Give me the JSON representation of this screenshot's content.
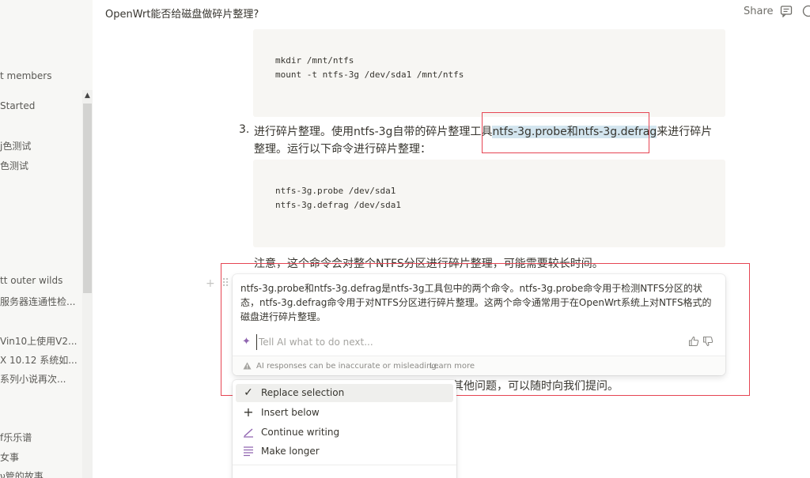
{
  "page": {
    "title": "OpenWrt能否给磁盘做碎片整理?",
    "share_label": "Share"
  },
  "sidebar": {
    "items": [
      {
        "label": "t members"
      },
      {
        "label": "Started"
      },
      {
        "label": "j色测试"
      },
      {
        "label": "色测试"
      },
      {
        "label": "tt outer wilds"
      },
      {
        "label": "服务器连通性检..."
      },
      {
        "label": "Vin10上使用V2..."
      },
      {
        "label": "X 10.12 系统如..."
      },
      {
        "label": "系列小说再次..."
      },
      {
        "label": "f乐乐谱"
      },
      {
        "label": "女事"
      },
      {
        "label": "ν管的故事"
      }
    ]
  },
  "content": {
    "code1": [
      "mkdir /mnt/ntfs",
      "mount -t ntfs-3g /dev/sda1 /mnt/ntfs"
    ],
    "step_number": "3.",
    "step_text_before": "进行碎片整理。使用ntfs-3g自带的碎片整理工具",
    "step_text_highlight": "ntfs-3g.probe和ntfs-3g.defrag",
    "step_text_after": "来进行碎片整理。运行以下命令进行碎片整理：",
    "code2": [
      "ntfs-3g.probe /dev/sda1",
      "ntfs-3g.defrag /dev/sda1"
    ],
    "note": "注意，这个命令会对整个NTFS分区进行碎片整理，可能需要较长时间。",
    "tail": "其他问题，可以随时向我们提问。"
  },
  "ai_panel": {
    "response": "ntfs-3g.probe和ntfs-3g.defrag是ntfs-3g工具包中的两个命令。ntfs-3g.probe命令用于检测NTFS分区的状态，ntfs-3g.defrag命令用于对NTFS分区进行碎片整理。这两个命令通常用于在OpenWrt系统上对NTFS格式的磁盘进行碎片整理。",
    "input_placeholder": "Tell AI what to do next...",
    "disclaimer": "AI responses can be inaccurate or misleading.",
    "learn_more": "Learn more"
  },
  "menu": {
    "items": [
      {
        "label": "Replace selection",
        "icon": "check-icon"
      },
      {
        "label": "Insert below",
        "icon": "plus-icon"
      },
      {
        "label": "Continue writing",
        "icon": "pen-icon"
      },
      {
        "label": "Make longer",
        "icon": "lines-icon"
      }
    ]
  },
  "colors": {
    "accent": "#9065b0",
    "highlight": "#d3e5ef",
    "annotation": "#e64553"
  }
}
